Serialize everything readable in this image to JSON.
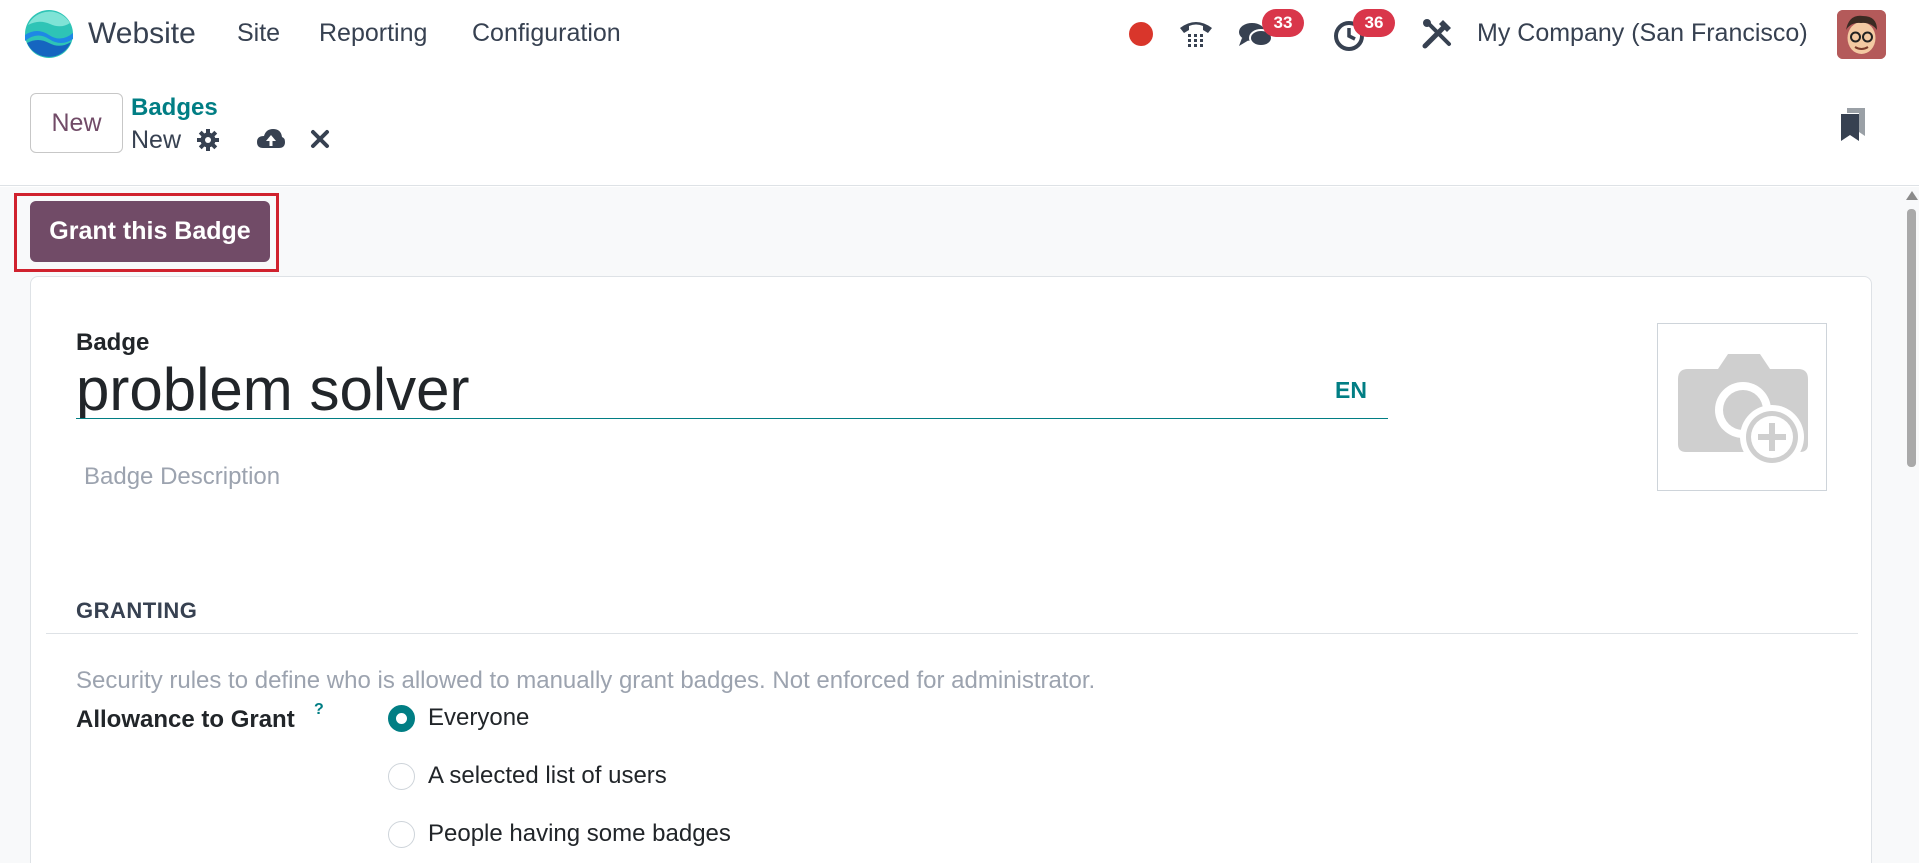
{
  "navbar": {
    "app_name": "Website",
    "menu": [
      {
        "label": "Site"
      },
      {
        "label": "Reporting"
      },
      {
        "label": "Configuration"
      }
    ],
    "recording_indicator_color": "#d9362b",
    "messages_count": "33",
    "activities_count": "36",
    "company": "My Company (San Francisco)",
    "icons": [
      "phone-icon",
      "chat-icon",
      "clock-icon",
      "tools-icon"
    ]
  },
  "control_panel": {
    "new_label": "New",
    "breadcrumb": "Badges",
    "record_name": "New"
  },
  "actions": {
    "grant_label": "Grant this Badge"
  },
  "form": {
    "badge_label": "Badge",
    "badge_name": "problem solver",
    "lang": "EN",
    "description_placeholder": "Badge Description",
    "section_title": "GRANTING",
    "help_text": "Security rules to define who is allowed to manually grant badges. Not enforced for administrator.",
    "allowance_label": "Allowance to Grant",
    "help_mark": "?",
    "options": [
      {
        "label": "Everyone",
        "checked": true
      },
      {
        "label": "A selected list of users",
        "checked": false
      },
      {
        "label": "People having some badges",
        "checked": false
      }
    ]
  },
  "colors": {
    "brand": "#714b67",
    "accent": "#017e84",
    "badge_red": "#d9364a",
    "highlight": "#d0222e"
  }
}
